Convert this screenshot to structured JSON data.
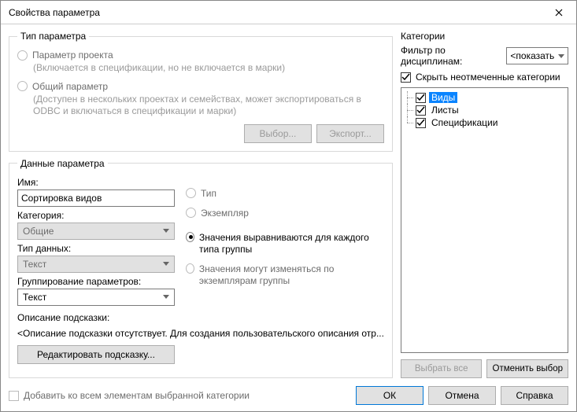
{
  "title": "Свойства параметра",
  "param_type": {
    "legend": "Тип параметра",
    "project": {
      "label": "Параметр проекта",
      "desc": "(Включается в спецификации, но не включается в марки)"
    },
    "shared": {
      "label": "Общий параметр",
      "desc": "(Доступен в нескольких проектах и семействах, может экспортироваться в ODBC и включаться в спецификации и марки)"
    },
    "btn_select": "Выбор...",
    "btn_export": "Экспорт..."
  },
  "param_data": {
    "legend": "Данные параметра",
    "name_label": "Имя:",
    "name_value": "Сортировка видов",
    "category_label": "Категория:",
    "category_value": "Общие",
    "datatype_label": "Тип данных:",
    "datatype_value": "Текст",
    "grouping_label": "Группирование параметров:",
    "grouping_value": "Текст",
    "type_label": "Тип",
    "instance_label": "Экземпляр",
    "align_per_group": "Значения выравниваются для каждого типа группы",
    "vary_per_instance": "Значения могут изменяться по экземплярам группы",
    "tooltip_label": "Описание подсказки:",
    "tooltip_text": "<Описание подсказки отсутствует. Для создания пользовательского описания отр...",
    "edit_tooltip_btn": "Редактировать подсказку..."
  },
  "categories": {
    "legend": "Категории",
    "filter_label": "Фильтр по дисциплинам:",
    "filter_value": "<показать",
    "hide_unchecked_label": "Скрыть неотмеченные категории",
    "items": [
      {
        "label": "Виды",
        "checked": true,
        "selected": true
      },
      {
        "label": "Листы",
        "checked": true,
        "selected": false
      },
      {
        "label": "Спецификации",
        "checked": true,
        "selected": false
      }
    ],
    "select_all_btn": "Выбрать все",
    "deselect_btn": "Отменить выбор"
  },
  "footer": {
    "add_all_label": "Добавить ко всем элементам выбранной категории",
    "ok": "ОК",
    "cancel": "Отмена",
    "help": "Справка"
  }
}
